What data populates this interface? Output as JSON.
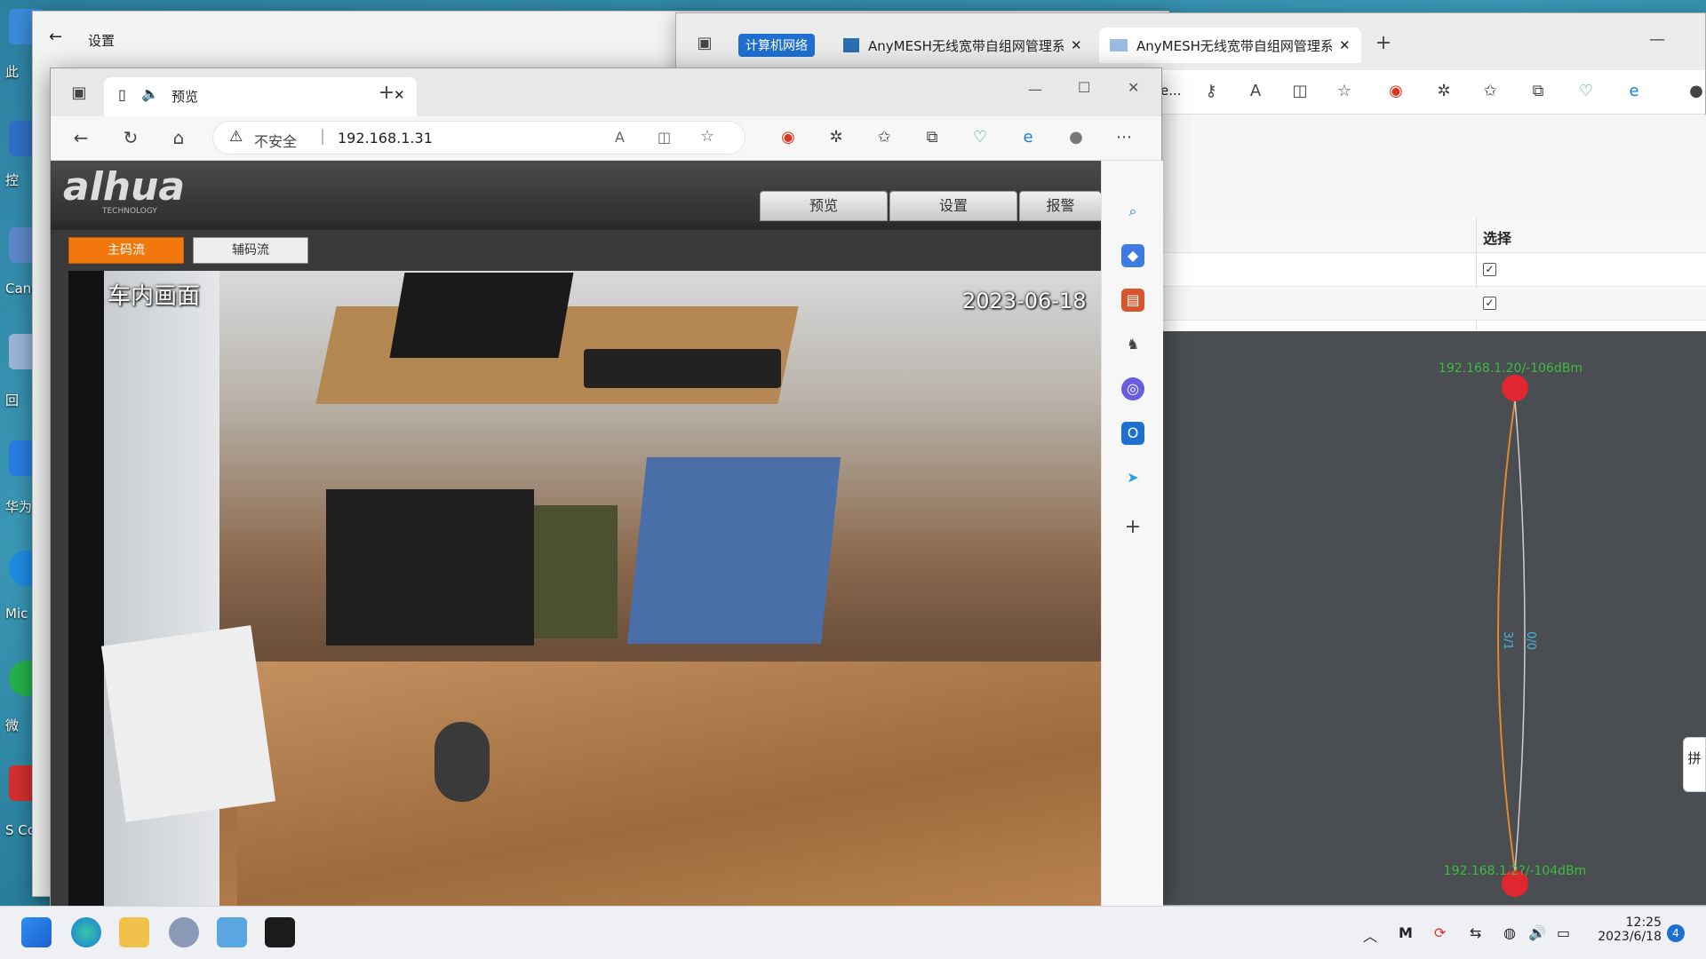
{
  "desktop": {
    "icons": [
      {
        "label": "此",
        "color": "#3b8ad8"
      },
      {
        "label": "控",
        "color": "#2f6fc5"
      },
      {
        "label": "Canc M",
        "color": "#5d87c8"
      },
      {
        "label": "回",
        "color": "#9ab4d6"
      },
      {
        "label": "华为",
        "color": "#2a7de1"
      },
      {
        "label": "Mic E",
        "color": "#1f8be0"
      },
      {
        "label": "微",
        "color": "#24b04a"
      },
      {
        "label": "S Cor",
        "color": "#d22f2f"
      }
    ]
  },
  "settings_window": {
    "title": "设置",
    "back_icon": "back-arrow-icon"
  },
  "browser2": {
    "tabs": [
      {
        "label": "计算机网络",
        "active": false
      },
      {
        "label": "AnyMESH无线宽带自组网管理系",
        "active": false
      },
      {
        "label": "AnyMESH无线宽带自组网管理系",
        "active": true
      }
    ],
    "address_fragment": "e...",
    "table": {
      "header": "选择",
      "rows": [
        {
          "checked": true
        },
        {
          "checked": true
        }
      ]
    },
    "topology": {
      "top_node": "192.168.1.20/-106dBm",
      "bottom_node": "192.168.1.2?/-104dBm",
      "link_left_label": "3/1",
      "link_right_label": "0/0",
      "node_color": "#e0262f",
      "label_color": "#3dbd3d",
      "link_color": "#e08a2c"
    },
    "window_controls": {
      "minimize": "—"
    }
  },
  "browser1": {
    "tab_title": "预览",
    "address": {
      "warning": "不安全",
      "url": "192.168.1.31"
    },
    "window_controls": {
      "minimize": "—",
      "maximize": "☐",
      "close": "✕"
    },
    "page": {
      "logo": "alhua",
      "logo_sub": "TECHNOLOGY",
      "nav": [
        "预览",
        "设置",
        "报警"
      ],
      "streams": [
        {
          "label": "主码流",
          "active": true
        },
        {
          "label": "辅码流",
          "active": false
        }
      ],
      "video": {
        "overlay_title": "车内画面",
        "overlay_date": "2023-06-18"
      }
    },
    "sidebar_icons": [
      "search-icon",
      "tag-icon",
      "toolbox-icon",
      "chess-icon",
      "copilot-icon",
      "outlook-icon",
      "send-icon",
      "plus-icon"
    ]
  },
  "taskbar": {
    "apps": [
      "start-icon",
      "edge-icon",
      "file-explorer-icon",
      "settings-gear-icon",
      "control-panel-icon",
      "terminal-icon"
    ],
    "clock": {
      "time": "12:25",
      "date": "2023/6/18"
    },
    "notification_count": "4"
  },
  "side_widget": {
    "text": "拼"
  }
}
